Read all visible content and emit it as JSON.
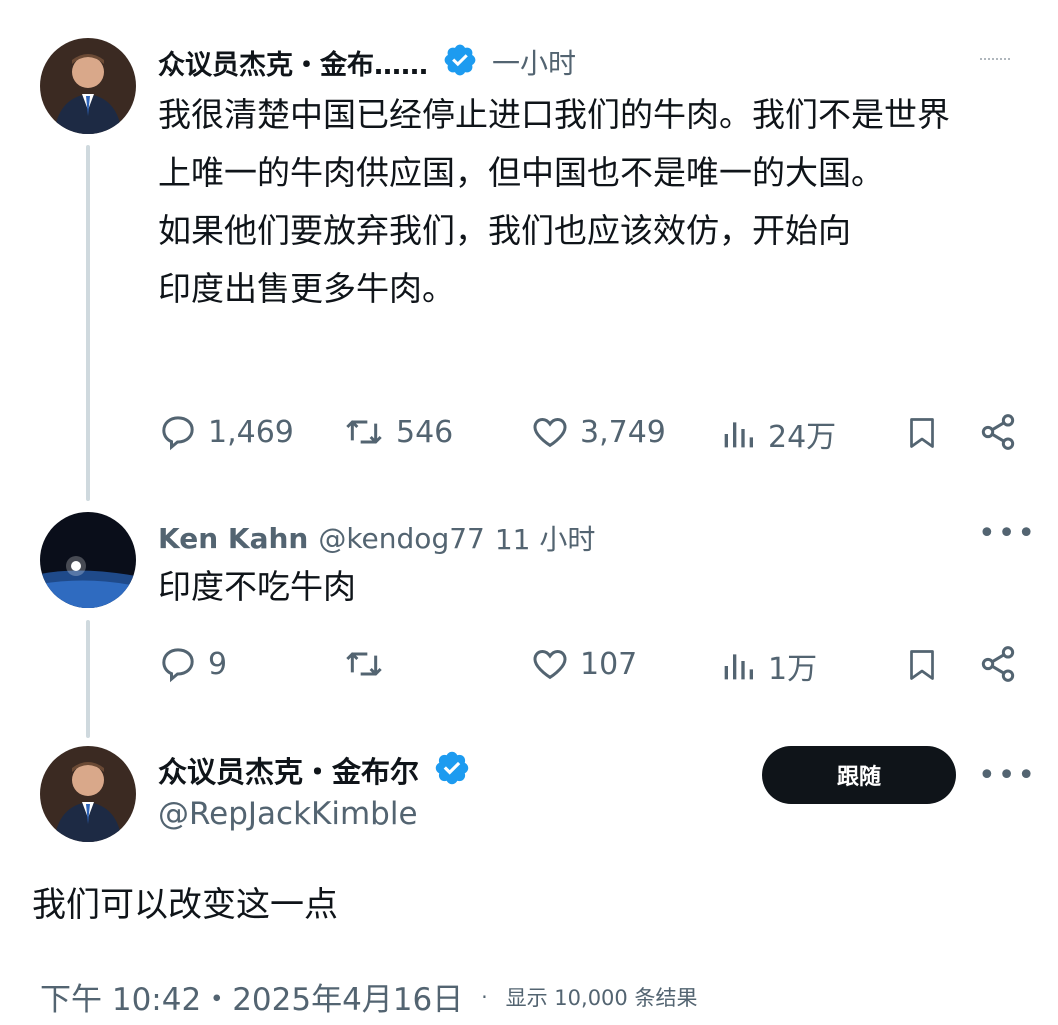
{
  "tweet1": {
    "author": "众议员杰克・金布……",
    "time": "一小时",
    "text_lines": [
      "我很清楚中国已经停止进口我们的牛肉。我们不是世界",
      "上唯一的牛肉供应国，但中国也不是唯一的大国。",
      "如果他们要放弃我们，我们也应该效仿，开始向",
      "印度出售更多牛肉。"
    ],
    "replies": "1,469",
    "reposts": "546",
    "likes": "3,749",
    "views": "24万"
  },
  "tweet2": {
    "author": "Ken Kahn",
    "handle": "@kendog77",
    "time": "11 小时",
    "text": "印度不吃牛肉",
    "replies": "9",
    "likes": "107",
    "views": "1万"
  },
  "tweet3": {
    "author": "众议员杰克・金布尔",
    "handle": "@RepJackKimble",
    "follow_label": "跟随",
    "text": "我们可以改变这一点",
    "timestamp": "下午 10:42・2025年4月16日",
    "results_label": "显示 10,000 条结果"
  },
  "icons": {
    "reply": "reply-icon",
    "repost": "repost-icon",
    "like": "heart-icon",
    "views": "views-icon",
    "bookmark": "bookmark-icon",
    "share": "share-icon",
    "verified": "verified-badge-icon",
    "more": "more-icon"
  },
  "colors": {
    "verified_blue": "#1d9bf0",
    "text": "#0f1419",
    "secondary": "#536471",
    "follow_button": "#0f1419"
  }
}
